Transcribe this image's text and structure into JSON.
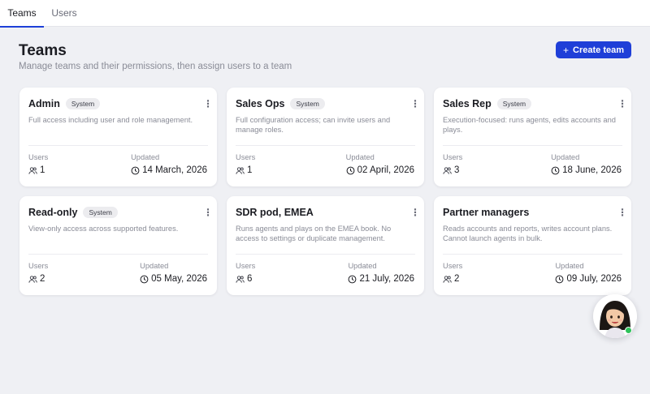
{
  "tabs": [
    {
      "label": "Teams",
      "active": true
    },
    {
      "label": "Users",
      "active": false
    }
  ],
  "header": {
    "title": "Teams",
    "subtitle": "Manage teams and their permissions, then assign users to a team",
    "create_button": "Create team",
    "create_icon": "+"
  },
  "labels": {
    "users": "Users",
    "updated": "Updated"
  },
  "teams": [
    {
      "name": "Admin",
      "badge": "System",
      "description": "Full access including user and role management.",
      "users": "1",
      "updated": "14 March, 2026"
    },
    {
      "name": "Sales Ops",
      "badge": "System",
      "description": "Full configuration access; can invite users and manage roles.",
      "users": "1",
      "updated": "02 April, 2026"
    },
    {
      "name": "Sales Rep",
      "badge": "System",
      "description": "Execution-focused: runs agents, edits accounts and plays.",
      "users": "3",
      "updated": "18 June, 2026"
    },
    {
      "name": "Read-only",
      "badge": "System",
      "description": "View-only access across supported features.",
      "users": "2",
      "updated": "05 May, 2026"
    },
    {
      "name": "SDR pod, EMEA",
      "badge": "",
      "description": "Runs agents and plays on the EMEA book. No access to settings or duplicate management.",
      "users": "6",
      "updated": "21 July, 2026"
    },
    {
      "name": "Partner managers",
      "badge": "",
      "description": "Reads accounts and reports, writes account plans. Cannot launch agents in bulk.",
      "users": "2",
      "updated": "09 July, 2026"
    }
  ],
  "menu_icon": "⋮",
  "colors": {
    "accent": "#1f3fd8",
    "background": "#eff0f4",
    "online": "#2ec25a"
  }
}
